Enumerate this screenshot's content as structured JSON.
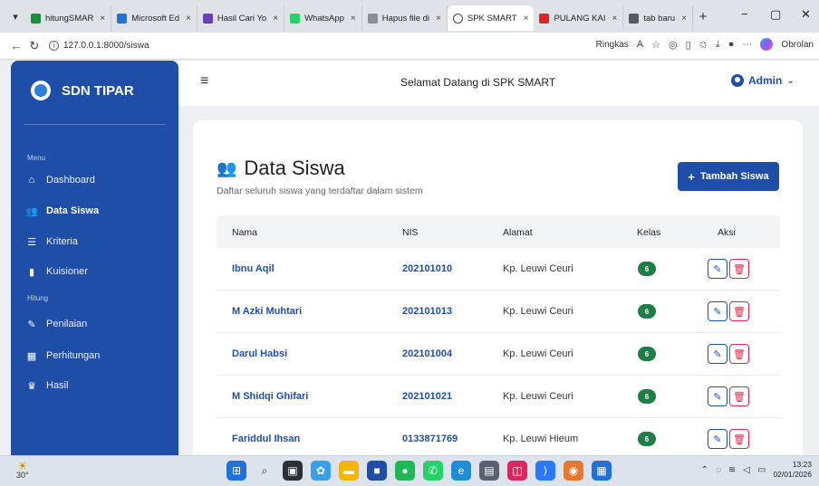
{
  "browser": {
    "tabs": [
      {
        "label": "hitungSMAR",
        "color": "#1e8e3e"
      },
      {
        "label": "Microsoft Ed",
        "color": "#1e72d9"
      },
      {
        "label": "Hasil Cari Yo",
        "color": "#6b3fb8"
      },
      {
        "label": "WhatsApp",
        "color": "#25d366"
      },
      {
        "label": "Hapus file di",
        "color": "#8a8f96"
      },
      {
        "label": "SPK SMART",
        "color": "#ffffff",
        "active": true
      },
      {
        "label": "PULANG KAI",
        "color": "#e02424"
      },
      {
        "label": "tab baru",
        "color": "#555b63"
      }
    ],
    "tab_close": "×",
    "new_tab": "+",
    "minimize": "−",
    "restore": "▢",
    "close": "✕",
    "url": "127.0.0.1:8000/siswa",
    "reader_label": "Ringkas",
    "more": "···",
    "copilot_label": "Obrolan"
  },
  "sidebar": {
    "brand": "SDN TIPAR",
    "menu_heading": "Menu",
    "menu_items": [
      {
        "label": "Dashboard",
        "icon": "home-icon"
      },
      {
        "label": "Data Siswa",
        "icon": "users-icon",
        "active": true
      },
      {
        "label": "Kriteria",
        "icon": "list-icon"
      },
      {
        "label": "Kuisioner",
        "icon": "clipboard-icon"
      }
    ],
    "hitung_heading": "Hitung",
    "hitung_items": [
      {
        "label": "Penilaian",
        "icon": "edit-icon"
      },
      {
        "label": "Perhitungan",
        "icon": "calculator-icon"
      },
      {
        "label": "Hasil",
        "icon": "trophy-icon"
      }
    ]
  },
  "topbar": {
    "welcome": "Selamat Datang di SPK SMART",
    "user": "Admin"
  },
  "main": {
    "title": "Data Siswa",
    "subtitle": "Daftar seluruh siswa yang terdaftar dalam sistem",
    "add_button": "Tambah Siswa",
    "columns": [
      "Nama",
      "NIS",
      "Alamat",
      "Kelas",
      "Aksi"
    ],
    "rows": [
      {
        "nama": "Ibnu Aqil",
        "nis": "202101010",
        "alamat": "Kp. Leuwi Ceuri",
        "kelas": "6"
      },
      {
        "nama": "M Azki Muhtari",
        "nis": "202101013",
        "alamat": "Kp. Leuwi Ceuri",
        "kelas": "6"
      },
      {
        "nama": "Darul Habsi",
        "nis": "202101004",
        "alamat": "Kp. Leuwi Ceuri",
        "kelas": "6"
      },
      {
        "nama": "M Shidqi Ghifari",
        "nis": "202101021",
        "alamat": "Kp. Leuwi Ceuri",
        "kelas": "6"
      },
      {
        "nama": "Fariddul Ihsan",
        "nis": "0133871769",
        "alamat": "Kp. Leuwi Hieum",
        "kelas": "6"
      }
    ]
  },
  "taskbar": {
    "temperature": "30°",
    "time": "13:23",
    "date": "02/01/2026"
  }
}
